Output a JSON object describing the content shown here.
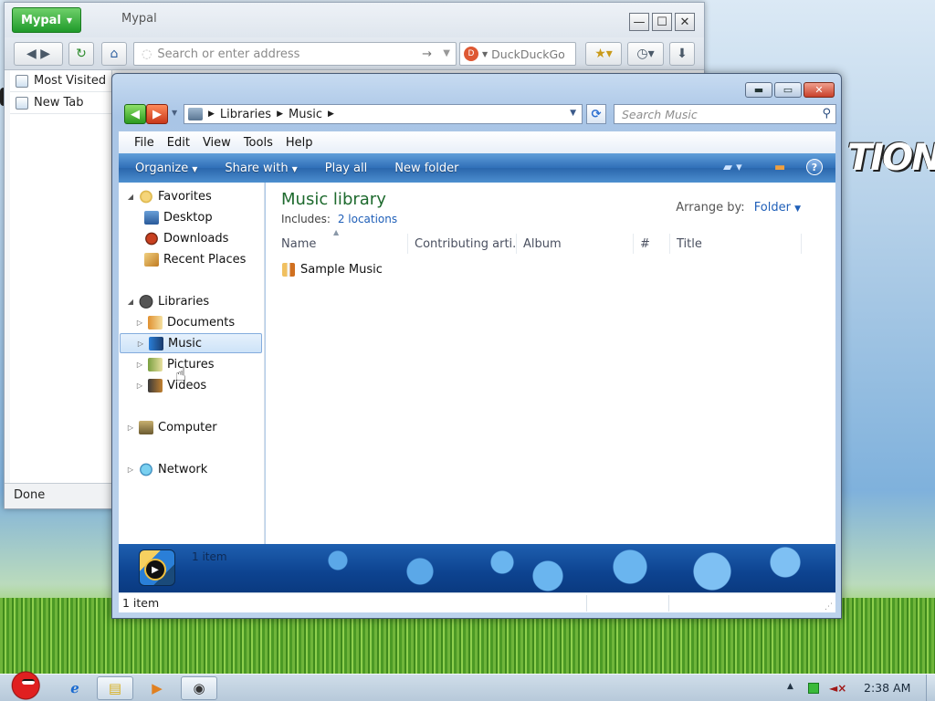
{
  "desktop": {
    "deco_text": "TION"
  },
  "mypal": {
    "menu_button": "Mypal",
    "title": "Mypal",
    "url_placeholder": "Search or enter address",
    "search_engine": "DuckDuckGo",
    "search_placeholder": "DuckDuckGo",
    "bookmarks": [
      "Most Visited",
      "New Tab"
    ],
    "status": "Done"
  },
  "explorer": {
    "breadcrumb": [
      "Libraries",
      "Music"
    ],
    "search_placeholder": "Search Music",
    "menu": [
      "File",
      "Edit",
      "View",
      "Tools",
      "Help"
    ],
    "commands": {
      "organize": "Organize",
      "share_with": "Share with",
      "play_all": "Play all",
      "new_folder": "New folder"
    },
    "nav": {
      "favorites": "Favorites",
      "desktop": "Desktop",
      "downloads": "Downloads",
      "recent_places": "Recent Places",
      "libraries": "Libraries",
      "documents": "Documents",
      "music": "Music",
      "pictures": "Pictures",
      "videos": "Videos",
      "computer": "Computer",
      "network": "Network"
    },
    "selected_nav": "Music",
    "library": {
      "title": "Music library",
      "includes_label": "Includes:",
      "includes_link": "2 locations",
      "arrange_label": "Arrange by:",
      "arrange_value": "Folder"
    },
    "columns": [
      "Name",
      "Contributing arti...",
      "Album",
      "#",
      "Title"
    ],
    "items": [
      {
        "name": "Sample Music",
        "icon": "music-folder-icon"
      }
    ],
    "details_count": "1 item",
    "status_count": "1 item",
    "colors": {
      "library_title": "#1e6a2e",
      "link": "#1f5fb8",
      "command_bar": "#2f6fb8"
    }
  },
  "taskbar": {
    "clock": "2:38 AM",
    "pinned": [
      "internet-explorer-icon",
      "file-explorer-icon",
      "media-player-icon",
      "mypal-icon"
    ]
  }
}
